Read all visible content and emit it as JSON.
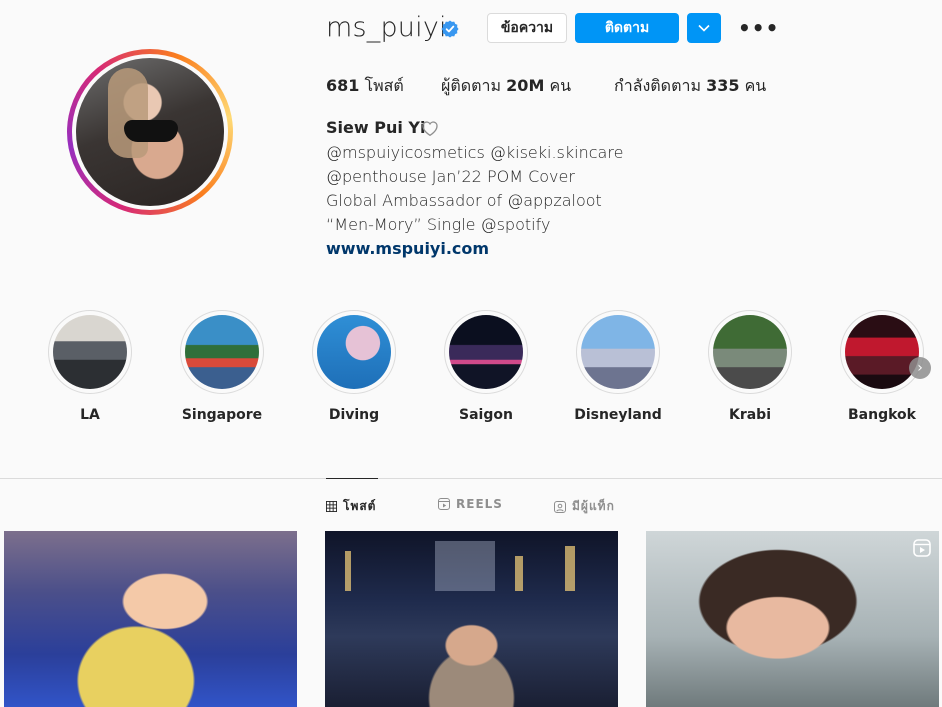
{
  "profile": {
    "username": "ms_puiyi",
    "verified": true,
    "buttons": {
      "message": "ข้อความ",
      "follow": "ติดตาม"
    },
    "stats": {
      "posts_count": "681",
      "posts_label": "โพสต์",
      "followers_label": "ผู้ติดตาม",
      "followers_count": "20M",
      "followers_unit": "คน",
      "following_label": "กำลังติดตาม",
      "following_count": "335",
      "following_unit": "คน"
    },
    "bio": {
      "name": "Siew Pui Yi",
      "lines": [
        "@mspuiyicosmetics @kiseki.skincare",
        "@penthouse Jan’22 POM Cover",
        "Global Ambassador of @appzaloot",
        "“Men-Mory” Single @spotify"
      ],
      "link": "www.mspuiyi.com"
    }
  },
  "highlights": [
    {
      "label": "LA",
      "icon": "highlight-la-photo"
    },
    {
      "label": "Singapore",
      "icon": "highlight-singapore-photo"
    },
    {
      "label": "Diving",
      "icon": "highlight-diving-photo"
    },
    {
      "label": "Saigon",
      "icon": "highlight-saigon-photo"
    },
    {
      "label": "Disneyland",
      "icon": "highlight-disneyland-photo"
    },
    {
      "label": "Krabi",
      "icon": "highlight-krabi-photo"
    },
    {
      "label": "Bangkok",
      "icon": "highlight-bangkok-photo"
    }
  ],
  "tabs": [
    {
      "label": "โพสต์",
      "icon": "grid-icon",
      "active": true
    },
    {
      "label": "REELS",
      "icon": "reels-icon",
      "active": false
    },
    {
      "label": "มีผู้แท็ก",
      "icon": "tagged-icon",
      "active": false
    }
  ],
  "colors": {
    "follow_button": "#0095f6",
    "link": "#00376b",
    "verified": "#3897f0"
  }
}
